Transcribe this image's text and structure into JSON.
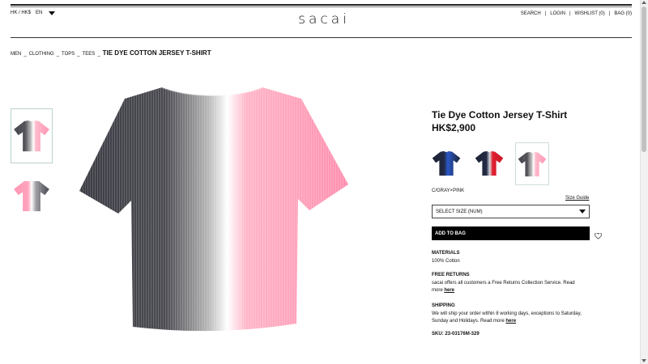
{
  "locale": {
    "region": "HK / HK$",
    "language": "EN"
  },
  "logo": {
    "text": "sacai"
  },
  "topnav": {
    "search": "SEARCH",
    "login": "LOGIN",
    "wishlist": "WISHLIST (0)",
    "bag": "BAG (0)",
    "separator": "|"
  },
  "breadcrumb": {
    "items": [
      "MEN",
      "CLOTHING",
      "TOPS",
      "TEES"
    ],
    "separator": "_",
    "current": "TIE DYE COTTON JERSEY T-SHIRT"
  },
  "product": {
    "name": "Tie Dye Cotton Jersey T-Shirt",
    "price": "HK$2,900",
    "color_label": "C/GRAY×PINK",
    "size_guide": "Size Guide",
    "size_select": "SELECT SIZE (NUM)",
    "add_to_bag": "ADD TO BAG",
    "materials_title": "MATERIALS",
    "materials_text": "100% Cotton",
    "returns_title": "FREE RETURNS",
    "returns_text": "sacai offers all customers a Free Returns Collection Service. Read more ",
    "returns_link": "here",
    "shipping_title": "SHIPPING",
    "shipping_text": "We will ship your order within 8 working days, exceptions to Saturday, Sunday and Holidays. Read more ",
    "shipping_link": "here",
    "sku": "SKU: 23-03176M-329"
  },
  "swatches": [
    "navy-blue",
    "navy-red",
    "gray-pink"
  ],
  "colors": {
    "pink": "#ff8fae",
    "gray": "#45464d",
    "accent": "#000000"
  }
}
